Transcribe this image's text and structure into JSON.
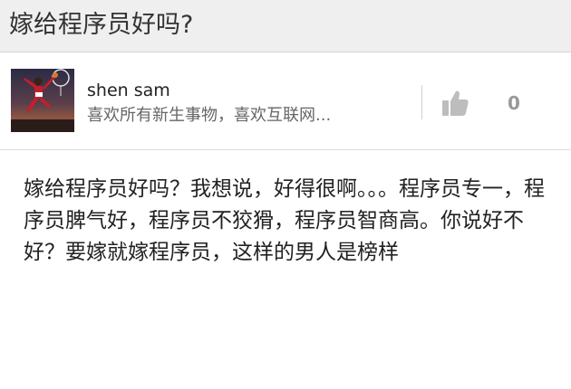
{
  "question": {
    "title": "嫁给程序员好吗?"
  },
  "answer": {
    "author": {
      "name": "shen sam",
      "bio": "喜欢所有新生事物，喜欢互联网..."
    },
    "votes": {
      "count": "0",
      "icon": "thumb-up-icon"
    },
    "body": "嫁给程序员好吗？我想说，好得很啊。。。程序员专一，程序员脾气好，程序员不狡猾，程序员智商高。你说好不好？要嫁就嫁程序员，这样的男人是榜样"
  },
  "colors": {
    "header_bg": "#efefef",
    "text_primary": "#222222",
    "text_secondary": "#666666",
    "vote_gray": "#bbbbbb"
  }
}
